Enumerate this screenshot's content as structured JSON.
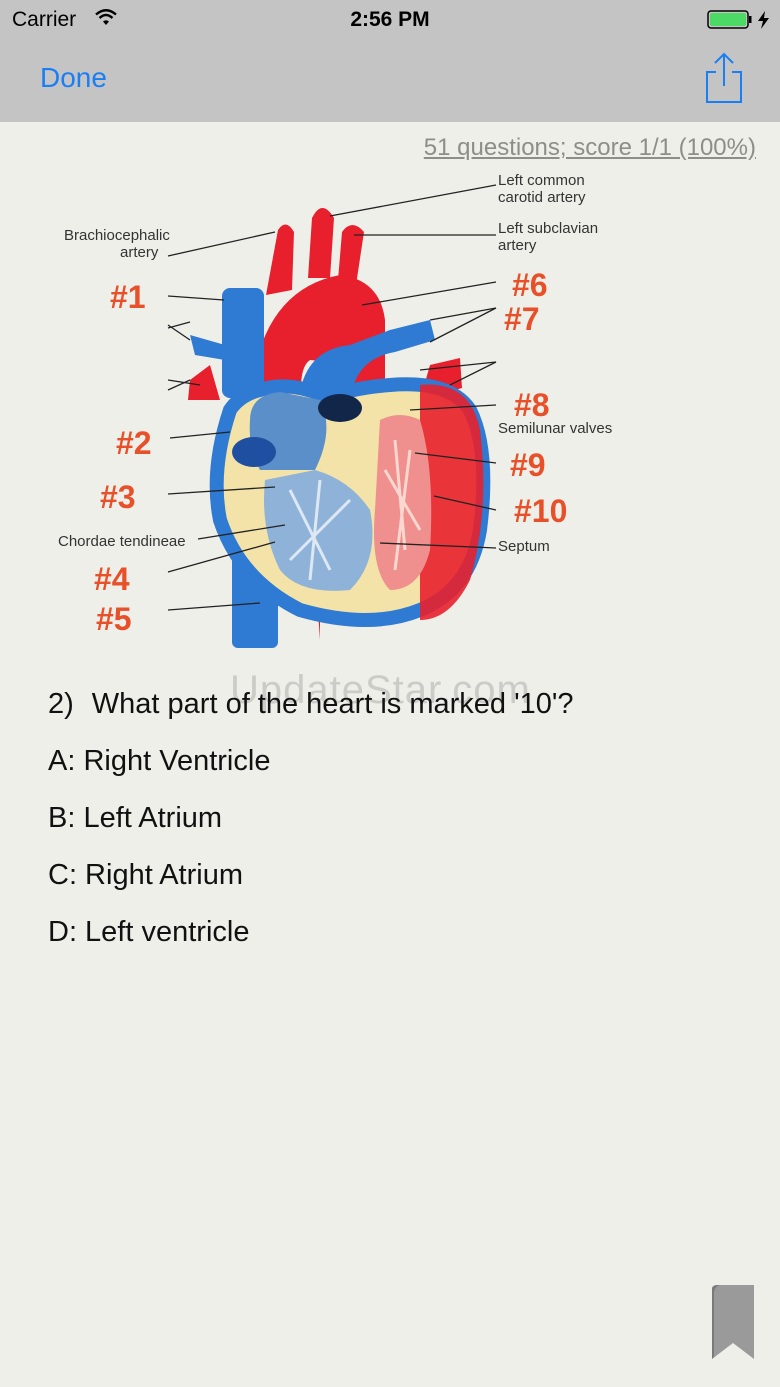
{
  "status_bar": {
    "carrier": "Carrier",
    "time": "2:56 PM",
    "battery_color": "#4cd964"
  },
  "nav": {
    "done_label": "Done",
    "share_icon": "share-icon",
    "accent_color": "#1a7ff5"
  },
  "quiz": {
    "score_text": "51 questions; score 1/1 (100%)",
    "question_number": "2)",
    "question_text": "What part of the heart is marked '10'?",
    "answers": [
      "A: Right Ventricle",
      "B: Left Atrium",
      "C: Right Atrium",
      "D: Left ventricle"
    ]
  },
  "diagram": {
    "labels": {
      "brachiocephalic_1": "Brachiocephalic",
      "brachiocephalic_2": "artery",
      "left_common_1": "Left common",
      "left_common_2": "carotid artery",
      "left_subclavian_1": "Left subclavian",
      "left_subclavian_2": "artery",
      "semilunar": "Semilunar valves",
      "chordae": "Chordae tendineae",
      "septum": "Septum"
    },
    "markers": [
      "#1",
      "#2",
      "#3",
      "#4",
      "#5",
      "#6",
      "#7",
      "#8",
      "#9",
      "#10"
    ]
  },
  "watermark": "UpdateStar.com",
  "bookmark_icon": "bookmark-icon"
}
